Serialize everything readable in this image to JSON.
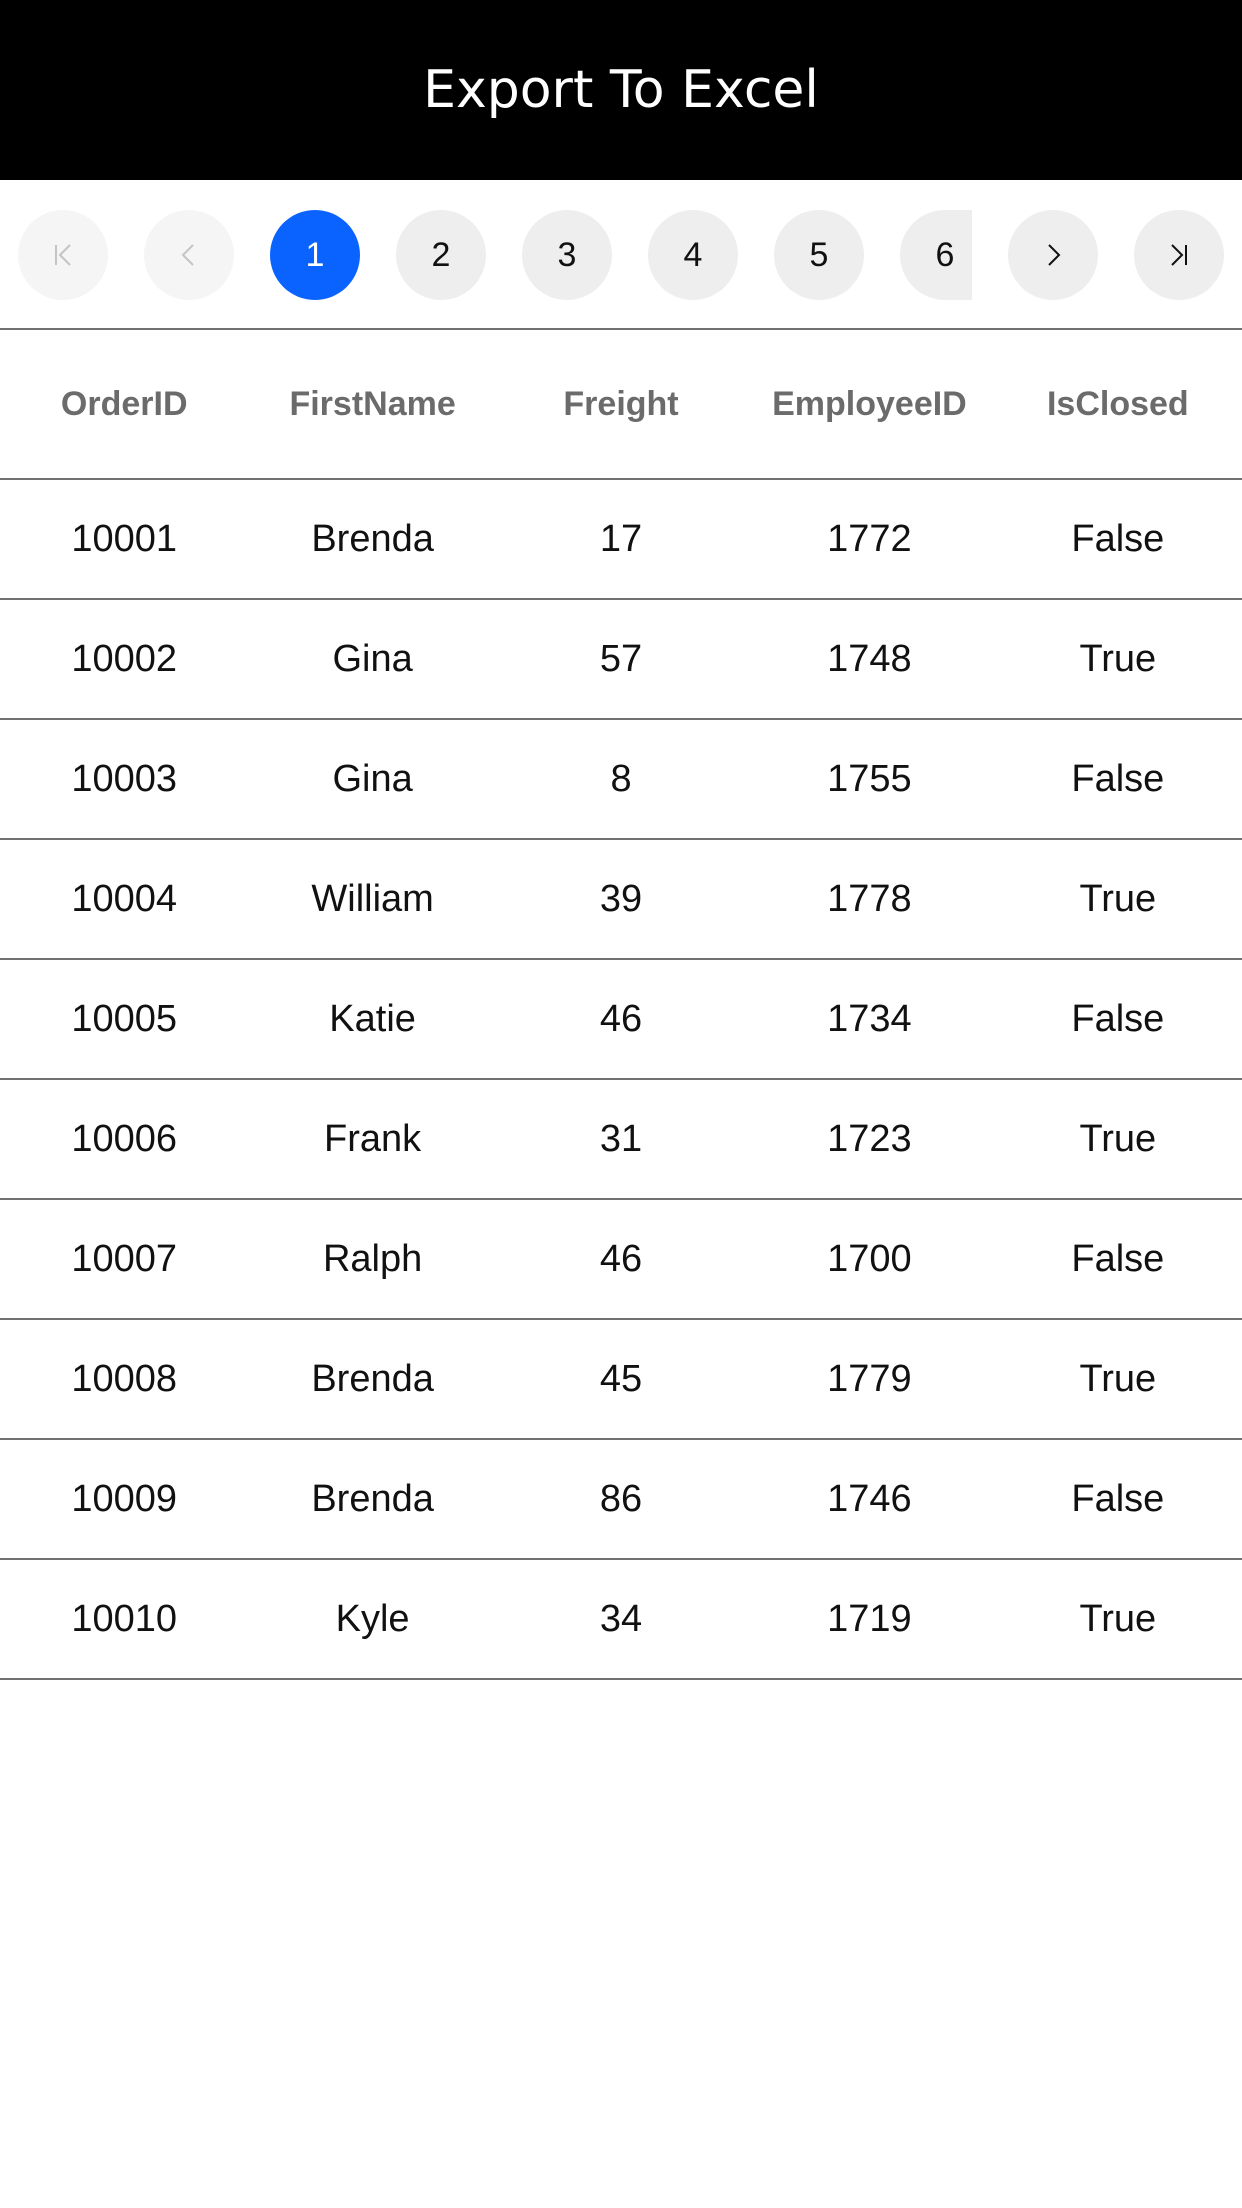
{
  "header": {
    "export_label": "Export To Excel"
  },
  "pager": {
    "pages": [
      "1",
      "2",
      "3",
      "4",
      "5",
      "6"
    ],
    "active_page": "1"
  },
  "grid": {
    "columns": [
      "OrderID",
      "FirstName",
      "Freight",
      "EmployeeID",
      "IsClosed"
    ],
    "rows": [
      [
        "10001",
        "Brenda",
        "17",
        "1772",
        "False"
      ],
      [
        "10002",
        "Gina",
        "57",
        "1748",
        "True"
      ],
      [
        "10003",
        "Gina",
        "8",
        "1755",
        "False"
      ],
      [
        "10004",
        "William",
        "39",
        "1778",
        "True"
      ],
      [
        "10005",
        "Katie",
        "46",
        "1734",
        "False"
      ],
      [
        "10006",
        "Frank",
        "31",
        "1723",
        "True"
      ],
      [
        "10007",
        "Ralph",
        "46",
        "1700",
        "False"
      ],
      [
        "10008",
        "Brenda",
        "45",
        "1779",
        "True"
      ],
      [
        "10009",
        "Brenda",
        "86",
        "1746",
        "False"
      ],
      [
        "10010",
        "Kyle",
        "34",
        "1719",
        "True"
      ]
    ]
  },
  "colors": {
    "topbar_bg": "#000000",
    "active_page": "#0a63ff",
    "page_button": "#eeeeee",
    "header_text": "#6b6b6b",
    "divider": "#707070"
  },
  "icons": {
    "first": "first-page-icon",
    "prev": "previous-page-icon",
    "next": "next-page-icon",
    "last": "last-page-icon"
  }
}
